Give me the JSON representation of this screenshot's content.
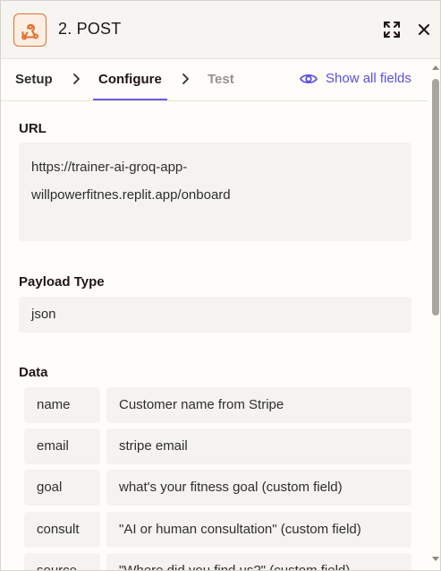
{
  "header": {
    "app_icon": "webhook-icon",
    "title": "2. POST",
    "expand_icon": "expand-icon",
    "close_icon": "close-icon"
  },
  "tabs": {
    "items": [
      {
        "label": "Setup",
        "state": "complete"
      },
      {
        "label": "Configure",
        "state": "active"
      },
      {
        "label": "Test",
        "state": "disabled"
      }
    ],
    "show_all_label": "Show all fields",
    "show_all_icon": "eye-icon"
  },
  "fields": {
    "url": {
      "label": "URL",
      "line1": "https://trainer-ai-groq-app-",
      "line2": "willpowerfitnes.replit.app/onboard"
    },
    "payload_type": {
      "label": "Payload Type",
      "value": "json"
    },
    "data": {
      "label": "Data",
      "rows": [
        {
          "key": "name",
          "value": "Customer name from Stripe"
        },
        {
          "key": "email",
          "value": "stripe email"
        },
        {
          "key": "goal",
          "value": "what's your fitness goal (custom field)"
        },
        {
          "key": "consult",
          "value": "\"AI or human consultation\" (custom field)"
        },
        {
          "key": "source",
          "value": "\"Where did you find us?\" (custom field)"
        }
      ]
    }
  },
  "colors": {
    "accent": "#695be8",
    "app_icon": "#e4702a",
    "field_bg": "#f5f3ef",
    "page_bg": "#fffdf9"
  }
}
